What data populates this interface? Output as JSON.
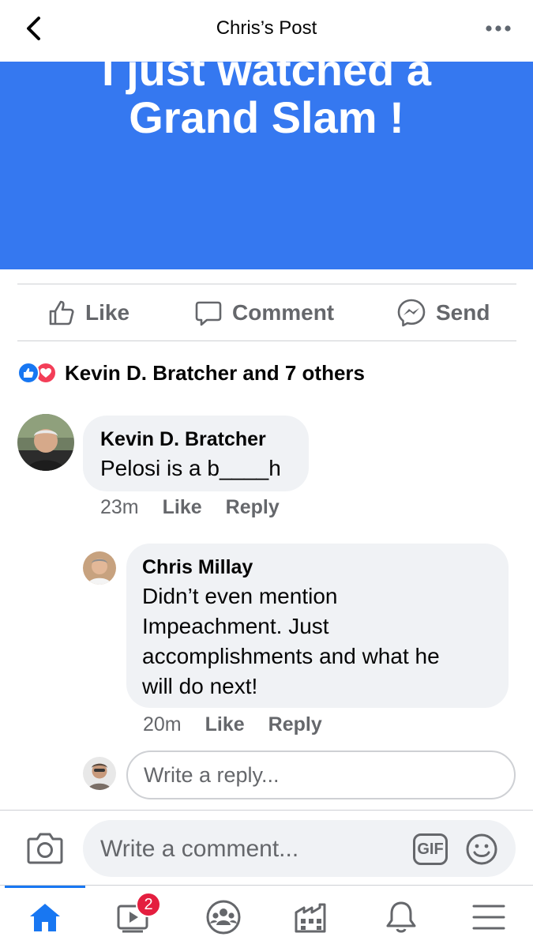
{
  "header": {
    "title": "Chris’s Post",
    "back_icon": "chevron-left-icon",
    "more_icon": "more-dots-icon"
  },
  "post": {
    "text_line1": "I just watched a",
    "text_line2": "Grand Slam !",
    "background_color": "#3578f0"
  },
  "actions": {
    "like": "Like",
    "comment": "Comment",
    "send": "Send"
  },
  "reactions": {
    "summary": "Kevin D. Bratcher and 7 others",
    "icons": [
      "like-reaction-icon",
      "love-reaction-icon"
    ]
  },
  "comments": [
    {
      "author": "Kevin D. Bratcher",
      "text": "Pelosi is a b____h",
      "time": "23m",
      "like": "Like",
      "reply": "Reply"
    },
    {
      "author": "Chris Millay",
      "lines": [
        "Didn’t even mention",
        "Impeachment. Just",
        "accomplishments and what he",
        "will do next!"
      ],
      "time": "20m",
      "like": "Like",
      "reply": "Reply"
    }
  ],
  "reply_box": {
    "placeholder": "Write a reply..."
  },
  "composer": {
    "placeholder": "Write a comment...",
    "gif_label": "GIF"
  },
  "tabbar": {
    "watch_badge": "2",
    "tabs": [
      "home-icon",
      "watch-icon",
      "groups-icon",
      "marketplace-icon",
      "notifications-icon",
      "menu-icon"
    ]
  },
  "colors": {
    "accent": "#1877f2",
    "badge": "#e41e3f",
    "love": "#f33e58"
  }
}
